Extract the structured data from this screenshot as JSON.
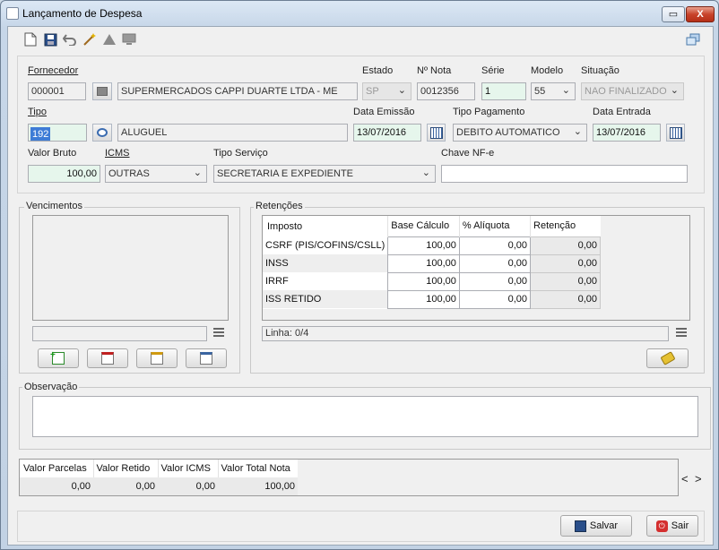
{
  "window": {
    "title": "Lançamento de Despesa",
    "minimize": "▭",
    "maximize": "□",
    "close": "X"
  },
  "toolbar": {
    "icons": [
      "new-document-icon",
      "save-icon",
      "undo-icon",
      "magic-wand-icon",
      "warning-icon",
      "monitor-icon",
      "windows-icon"
    ]
  },
  "form": {
    "fornecedor": {
      "label": "Fornecedor",
      "code": "000001",
      "name": "SUPERMERCADOS CAPPI DUARTE LTDA - ME"
    },
    "estado": {
      "label": "Estado",
      "value": "SP"
    },
    "nota": {
      "label": "Nº Nota",
      "value": "0012356"
    },
    "serie": {
      "label": "Série",
      "value": "1"
    },
    "modelo": {
      "label": "Modelo",
      "value": "55"
    },
    "situacao": {
      "label": "Situação",
      "value": "NAO FINALIZADO"
    },
    "tipo": {
      "label": "Tipo",
      "code": "192",
      "name": "ALUGUEL"
    },
    "data_emissao": {
      "label": "Data Emissão",
      "value": "13/07/2016"
    },
    "tipo_pagamento": {
      "label": "Tipo Pagamento",
      "value": "DEBITO AUTOMATICO"
    },
    "data_entrada": {
      "label": "Data Entrada",
      "value": "13/07/2016"
    },
    "valor_bruto": {
      "label": "Valor Bruto",
      "value": "100,00"
    },
    "icms": {
      "label": "ICMS",
      "value": "OUTRAS"
    },
    "tipo_servico": {
      "label": "Tipo Serviço",
      "value": "SECRETARIA E EXPEDIENTE"
    },
    "chave_nfe": {
      "label": "Chave NF-e",
      "value": ""
    }
  },
  "vencimentos": {
    "title": "Vencimentos"
  },
  "retencoes": {
    "title": "Retenções",
    "columns": [
      "Imposto",
      "Base Cálculo",
      "% Alíquota",
      "Retenção"
    ],
    "rows": [
      {
        "imposto": "CSRF (PIS/COFINS/CSLL)",
        "base": "100,00",
        "aliquota": "0,00",
        "retencao": "0,00"
      },
      {
        "imposto": "INSS",
        "base": "100,00",
        "aliquota": "0,00",
        "retencao": "0,00"
      },
      {
        "imposto": "IRRF",
        "base": "100,00",
        "aliquota": "0,00",
        "retencao": "0,00"
      },
      {
        "imposto": "ISS RETIDO",
        "base": "100,00",
        "aliquota": "0,00",
        "retencao": "0,00"
      }
    ],
    "linha": "Linha: 0/4"
  },
  "observacao": {
    "title": "Observação",
    "value": ""
  },
  "totals": {
    "columns": [
      "Valor Parcelas",
      "Valor Retido",
      "Valor ICMS",
      "Valor Total Nota"
    ],
    "values": [
      "0,00",
      "0,00",
      "0,00",
      "100,00"
    ],
    "nav_prev": "<",
    "nav_next": ">"
  },
  "actions": {
    "salvar": "Salvar",
    "sair": "Sair"
  }
}
